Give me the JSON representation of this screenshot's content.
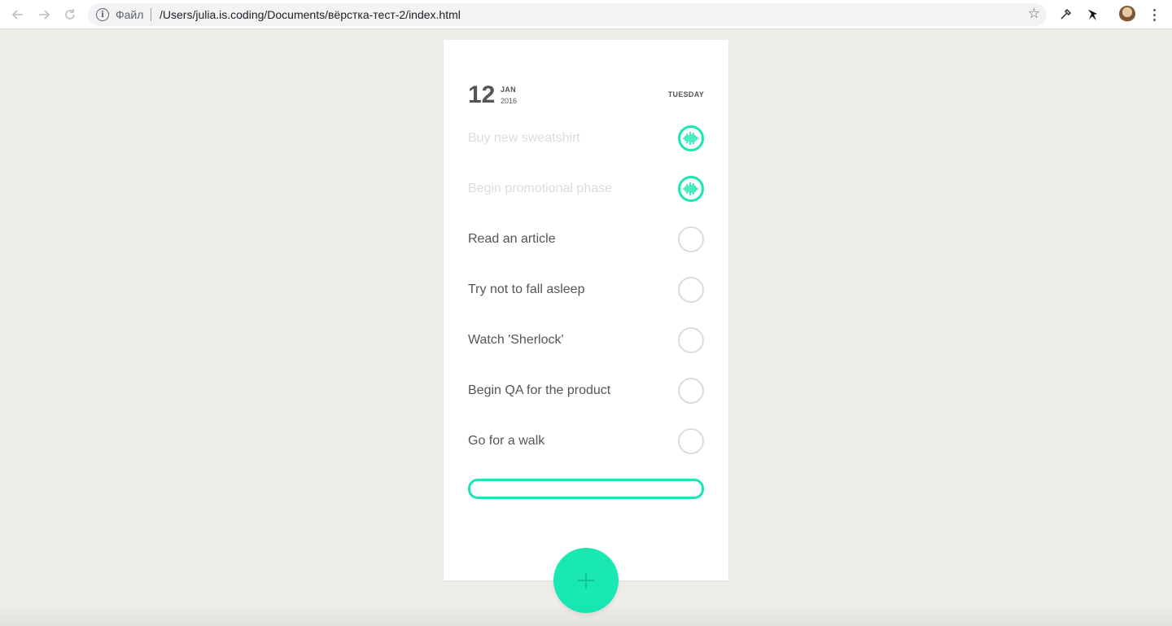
{
  "browser": {
    "scheme_label": "Файл",
    "url": "/Users/julia.is.coding/Documents/вёрстка-тест-2/index.html",
    "icons": [
      "back-icon",
      "forward-icon",
      "reload-icon",
      "info-icon",
      "star-icon",
      "eyedropper-icon",
      "extension-icon",
      "avatar",
      "menu-icon"
    ]
  },
  "date": {
    "day": "12",
    "month": "JAN",
    "year": "2016",
    "weekday": "TUESDAY"
  },
  "tasks": [
    {
      "label": "Buy new sweatshirt",
      "done": true
    },
    {
      "label": "Begin promotional phase",
      "done": true
    },
    {
      "label": "Read an article",
      "done": false
    },
    {
      "label": "Try not to fall asleep",
      "done": false
    },
    {
      "label": "Watch 'Sherlock'",
      "done": false
    },
    {
      "label": "Begin QA for the product",
      "done": false
    },
    {
      "label": "Go for a walk",
      "done": false
    }
  ],
  "new_task": {
    "value": "",
    "placeholder": ""
  },
  "fab": {
    "icon": "plus-icon"
  },
  "colors": {
    "accent": "#19e8b3",
    "background": "#efede8",
    "card": "#ffffff",
    "text": "#555555",
    "done_text": "#dcdcdc"
  }
}
